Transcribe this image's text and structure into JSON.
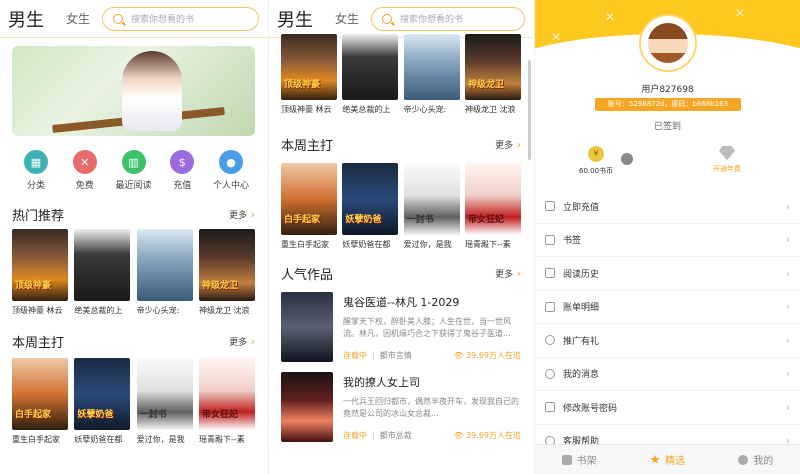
{
  "header": {
    "tab_male": "男生",
    "tab_female": "女生",
    "search_placeholder": "搜索你想看的书"
  },
  "nav": [
    {
      "label": "分类",
      "icon": "category-icon",
      "color": "#3cb2b2"
    },
    {
      "label": "免费",
      "icon": "free-icon",
      "color": "#e96b6b"
    },
    {
      "label": "最近阅读",
      "icon": "recent-reading-icon",
      "color": "#3cc26b"
    },
    {
      "label": "充值",
      "icon": "recharge-icon",
      "color": "#9b6be0"
    },
    {
      "label": "个人中心",
      "icon": "user-center-icon",
      "color": "#4a9de8"
    }
  ],
  "hot": {
    "title": "热门推荐",
    "more": "更多",
    "books": [
      {
        "name": "顶级神豪 林云",
        "cover_text": "顶级神豪"
      },
      {
        "name": "绝美总裁的上",
        "cover_text": ""
      },
      {
        "name": "帝少心头宠:",
        "cover_text": ""
      },
      {
        "name": "神级龙卫 沈浪",
        "cover_text": "神级龙卫"
      }
    ]
  },
  "weekly": {
    "title": "本周主打",
    "more": "更多",
    "books": [
      {
        "name": "重生白手起家",
        "cover_text": "白手起家"
      },
      {
        "name": "妖孽奶爸在都",
        "cover_text": "妖孽奶爸"
      },
      {
        "name": "爱过你，是我",
        "cover_text": "一封书"
      },
      {
        "name": "瑶青殿下--素",
        "cover_text": "帝女狂妃"
      }
    ]
  },
  "popular": {
    "title": "人气作品",
    "more": "更多",
    "items": [
      {
        "title": "鬼谷医道--林凡 1-2029",
        "desc": "醒掌天下权，醉卧美人膝；人生在世，当一世风流。林凡，因机缘巧合之下获得了鬼谷子医道...",
        "status": "连载中",
        "category": "都市言情",
        "count": "39.69万人在追"
      },
      {
        "title": "我的撩人女上司",
        "desc": "一代兵王回归都市，偶然半夜开车，发现我自己的竟然是公司的冰山女总裁...",
        "status": "连载中",
        "category": "都市总裁",
        "count": "39.69万人在追"
      }
    ]
  },
  "profile": {
    "username": "用户827698",
    "account": "账号：5298872d，密码：b868b163",
    "signed": "已签到",
    "coins": "60.00书币",
    "vip": "开通年费",
    "menu": [
      "立即充值",
      "书签",
      "阅读历史",
      "账单明细",
      "推广有礼",
      "我的消息",
      "修改账号密码",
      "客服帮助"
    ]
  },
  "tabbar": {
    "bookshelf": "书架",
    "featured": "精选",
    "mine": "我的"
  }
}
